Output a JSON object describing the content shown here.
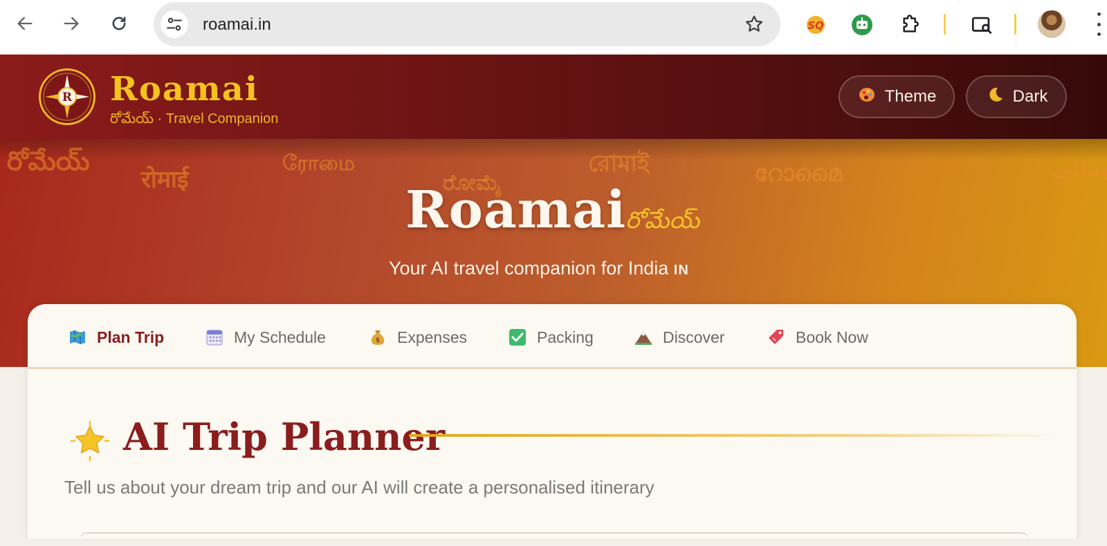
{
  "browser": {
    "url": "roamai.in",
    "icons": {
      "back": "back-arrow-icon",
      "forward": "forward-arrow-icon",
      "reload": "reload-icon",
      "site_info": "site-settings-icon",
      "bookmark": "bookmark-star-icon",
      "extensions": [
        "sq-extension-icon",
        "robot-extension-icon",
        "puzzle-extensions-icon",
        "lens-search-icon"
      ],
      "menu": "kebab-menu-icon"
    }
  },
  "header": {
    "brand_name": "Roamai",
    "tagline": "రోమేయ్ · Travel Companion",
    "logo_letter": "R",
    "theme_label": "Theme",
    "dark_label": "Dark"
  },
  "hero": {
    "background_words": [
      "రోమేయ్",
      "रोमाई",
      "ரோமை",
      "ರೋಮೈ",
      "রোমাই",
      "റോമൈ",
      "رومائی"
    ],
    "title": "Roamai",
    "title_telugu": "రోమేయ్",
    "subtitle": "Your AI travel companion for India",
    "subtitle_flag": "IN"
  },
  "tabs": [
    {
      "label": "Plan Trip",
      "icon": "map-icon",
      "active": true
    },
    {
      "label": "My Schedule",
      "icon": "calendar-icon",
      "active": false
    },
    {
      "label": "Expenses",
      "icon": "money-bag-icon",
      "active": false
    },
    {
      "label": "Packing",
      "icon": "checkbox-icon",
      "active": false
    },
    {
      "label": "Discover",
      "icon": "mountain-icon",
      "active": false
    },
    {
      "label": "Book Now",
      "icon": "ticket-icon",
      "active": false
    }
  ],
  "section": {
    "title": "AI Trip Planner",
    "description": "Tell us about your dream trip and our AI will create a personalised itinerary",
    "icon": "glowing-star-icon"
  },
  "colors": {
    "brand_gold": "#f4c21e",
    "brand_maroon": "#8a1d1d",
    "hero_start": "#a8281c",
    "hero_end": "#d99812"
  }
}
